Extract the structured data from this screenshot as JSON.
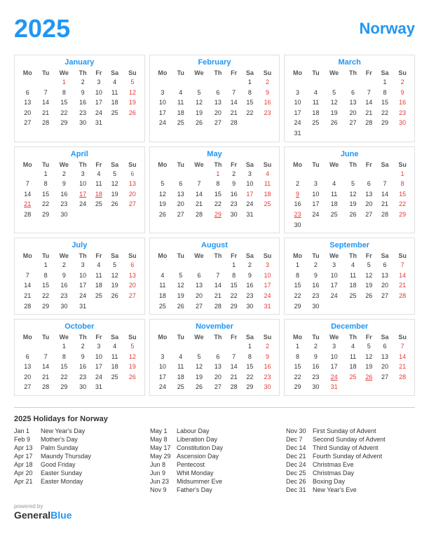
{
  "header": {
    "year": "2025",
    "country": "Norway"
  },
  "months": [
    {
      "name": "January",
      "days": [
        [
          "",
          "",
          "1",
          "2",
          "3",
          "4",
          "5"
        ],
        [
          "6",
          "7",
          "8",
          "9",
          "10",
          "11",
          "12"
        ],
        [
          "13",
          "14",
          "15",
          "16",
          "17",
          "18",
          "19"
        ],
        [
          "20",
          "21",
          "22",
          "23",
          "24",
          "25",
          "26"
        ],
        [
          "27",
          "28",
          "29",
          "30",
          "31",
          "",
          ""
        ]
      ],
      "red_days": [
        "1"
      ],
      "underline_days": []
    },
    {
      "name": "February",
      "days": [
        [
          "",
          "",
          "",
          "",
          "",
          "1",
          "2"
        ],
        [
          "3",
          "4",
          "5",
          "6",
          "7",
          "8",
          "9"
        ],
        [
          "10",
          "11",
          "12",
          "13",
          "14",
          "15",
          "16"
        ],
        [
          "17",
          "18",
          "19",
          "20",
          "21",
          "22",
          "23"
        ],
        [
          "24",
          "25",
          "26",
          "27",
          "28",
          "",
          ""
        ]
      ],
      "red_days": [],
      "underline_days": []
    },
    {
      "name": "March",
      "days": [
        [
          "",
          "",
          "",
          "",
          "",
          "1",
          "2"
        ],
        [
          "3",
          "4",
          "5",
          "6",
          "7",
          "8",
          "9"
        ],
        [
          "10",
          "11",
          "12",
          "13",
          "14",
          "15",
          "16"
        ],
        [
          "17",
          "18",
          "19",
          "20",
          "21",
          "22",
          "23"
        ],
        [
          "24",
          "25",
          "26",
          "27",
          "28",
          "29",
          "30"
        ],
        [
          "31",
          "",
          "",
          "",
          "",
          "",
          ""
        ]
      ],
      "red_days": [
        "2"
      ],
      "underline_days": []
    },
    {
      "name": "April",
      "days": [
        [
          "",
          "1",
          "2",
          "3",
          "4",
          "5",
          "6"
        ],
        [
          "7",
          "8",
          "9",
          "10",
          "11",
          "12",
          "13"
        ],
        [
          "14",
          "15",
          "16",
          "17",
          "18",
          "19",
          "20"
        ],
        [
          "21",
          "22",
          "23",
          "24",
          "25",
          "26",
          "27"
        ],
        [
          "28",
          "29",
          "30",
          "",
          "",
          "",
          ""
        ]
      ],
      "red_days": [
        "13",
        "20"
      ],
      "underline_days": [
        "17",
        "18",
        "21"
      ]
    },
    {
      "name": "May",
      "days": [
        [
          "",
          "",
          "",
          "1",
          "2",
          "3",
          "4"
        ],
        [
          "5",
          "6",
          "7",
          "8",
          "9",
          "10",
          "11"
        ],
        [
          "12",
          "13",
          "14",
          "15",
          "16",
          "17",
          "18"
        ],
        [
          "19",
          "20",
          "21",
          "22",
          "23",
          "24",
          "25"
        ],
        [
          "26",
          "27",
          "28",
          "29",
          "30",
          "31",
          ""
        ]
      ],
      "red_days": [
        "1",
        "4",
        "17"
      ],
      "underline_days": [
        "29"
      ]
    },
    {
      "name": "June",
      "days": [
        [
          "",
          "",
          "",
          "",
          "",
          "",
          "1"
        ],
        [
          "2",
          "3",
          "4",
          "5",
          "6",
          "7",
          "8"
        ],
        [
          "9",
          "10",
          "11",
          "12",
          "13",
          "14",
          "15"
        ],
        [
          "16",
          "17",
          "18",
          "19",
          "20",
          "21",
          "22"
        ],
        [
          "23",
          "24",
          "25",
          "26",
          "27",
          "28",
          "29"
        ],
        [
          "30",
          "",
          "",
          "",
          "",
          "",
          ""
        ]
      ],
      "red_days": [
        "1",
        "8"
      ],
      "underline_days": [
        "9",
        "23"
      ]
    },
    {
      "name": "July",
      "days": [
        [
          "",
          "1",
          "2",
          "3",
          "4",
          "5",
          "6"
        ],
        [
          "7",
          "8",
          "9",
          "10",
          "11",
          "12",
          "13"
        ],
        [
          "14",
          "15",
          "16",
          "17",
          "18",
          "19",
          "20"
        ],
        [
          "21",
          "22",
          "23",
          "24",
          "25",
          "26",
          "27"
        ],
        [
          "28",
          "29",
          "30",
          "31",
          "",
          "",
          ""
        ]
      ],
      "red_days": [],
      "underline_days": []
    },
    {
      "name": "August",
      "days": [
        [
          "",
          "",
          "",
          "",
          "1",
          "2",
          "3"
        ],
        [
          "4",
          "5",
          "6",
          "7",
          "8",
          "9",
          "10"
        ],
        [
          "11",
          "12",
          "13",
          "14",
          "15",
          "16",
          "17"
        ],
        [
          "18",
          "19",
          "20",
          "21",
          "22",
          "23",
          "24"
        ],
        [
          "25",
          "26",
          "27",
          "28",
          "29",
          "30",
          "31"
        ]
      ],
      "red_days": [],
      "underline_days": []
    },
    {
      "name": "September",
      "days": [
        [
          "1",
          "2",
          "3",
          "4",
          "5",
          "6",
          "7"
        ],
        [
          "8",
          "9",
          "10",
          "11",
          "12",
          "13",
          "14"
        ],
        [
          "15",
          "16",
          "17",
          "18",
          "19",
          "20",
          "21"
        ],
        [
          "22",
          "23",
          "24",
          "25",
          "26",
          "27",
          "28"
        ],
        [
          "29",
          "30",
          "",
          "",
          "",
          "",
          ""
        ]
      ],
      "red_days": [],
      "underline_days": []
    },
    {
      "name": "October",
      "days": [
        [
          "",
          "",
          "1",
          "2",
          "3",
          "4",
          "5"
        ],
        [
          "6",
          "7",
          "8",
          "9",
          "10",
          "11",
          "12"
        ],
        [
          "13",
          "14",
          "15",
          "16",
          "17",
          "18",
          "19"
        ],
        [
          "20",
          "21",
          "22",
          "23",
          "24",
          "25",
          "26"
        ],
        [
          "27",
          "28",
          "29",
          "30",
          "31",
          "",
          ""
        ]
      ],
      "red_days": [],
      "underline_days": []
    },
    {
      "name": "November",
      "days": [
        [
          "",
          "",
          "",
          "",
          "",
          "1",
          "2"
        ],
        [
          "3",
          "4",
          "5",
          "6",
          "7",
          "8",
          "9"
        ],
        [
          "10",
          "11",
          "12",
          "13",
          "14",
          "15",
          "16"
        ],
        [
          "17",
          "18",
          "19",
          "20",
          "21",
          "22",
          "23"
        ],
        [
          "24",
          "25",
          "26",
          "27",
          "28",
          "29",
          "30"
        ]
      ],
      "red_days": [
        "9",
        "30"
      ],
      "underline_days": []
    },
    {
      "name": "December",
      "days": [
        [
          "1",
          "2",
          "3",
          "4",
          "5",
          "6",
          "7"
        ],
        [
          "8",
          "9",
          "10",
          "11",
          "12",
          "13",
          "14"
        ],
        [
          "15",
          "16",
          "17",
          "18",
          "19",
          "20",
          "21"
        ],
        [
          "22",
          "23",
          "24",
          "25",
          "26",
          "27",
          "28"
        ],
        [
          "29",
          "30",
          "31",
          "",
          "",
          "",
          ""
        ]
      ],
      "red_days": [
        "7",
        "14",
        "21",
        "25",
        "31"
      ],
      "underline_days": [
        "24",
        "26"
      ]
    }
  ],
  "weekdays": [
    "Mo",
    "Tu",
    "We",
    "Th",
    "Fr",
    "Sa",
    "Su"
  ],
  "holidays_title": "2025 Holidays for Norway",
  "holidays_col1": [
    {
      "date": "Jan 1",
      "name": "New Year's Day"
    },
    {
      "date": "Feb 9",
      "name": "Mother's Day"
    },
    {
      "date": "Apr 13",
      "name": "Palm Sunday"
    },
    {
      "date": "Apr 17",
      "name": "Maundy Thursday"
    },
    {
      "date": "Apr 18",
      "name": "Good Friday"
    },
    {
      "date": "Apr 20",
      "name": "Easter Sunday"
    },
    {
      "date": "Apr 21",
      "name": "Easter Monday"
    }
  ],
  "holidays_col2": [
    {
      "date": "May 1",
      "name": "Labour Day"
    },
    {
      "date": "May 8",
      "name": "Liberation Day"
    },
    {
      "date": "May 17",
      "name": "Constitution Day"
    },
    {
      "date": "May 29",
      "name": "Ascension Day"
    },
    {
      "date": "Jun 8",
      "name": "Pentecost"
    },
    {
      "date": "Jun 9",
      "name": "Whit Monday"
    },
    {
      "date": "Jun 23",
      "name": "Midsummer Eve"
    },
    {
      "date": "Nov 9",
      "name": "Father's Day"
    }
  ],
  "holidays_col3": [
    {
      "date": "Nov 30",
      "name": "First Sunday of Advent"
    },
    {
      "date": "Dec 7",
      "name": "Second Sunday of Advent"
    },
    {
      "date": "Dec 14",
      "name": "Third Sunday of Advent"
    },
    {
      "date": "Dec 21",
      "name": "Fourth Sunday of Advent"
    },
    {
      "date": "Dec 24",
      "name": "Christmas Eve"
    },
    {
      "date": "Dec 25",
      "name": "Christmas Day"
    },
    {
      "date": "Dec 26",
      "name": "Boxing Day"
    },
    {
      "date": "Dec 31",
      "name": "New Year's Eve"
    }
  ],
  "footer": {
    "powered_by": "powered by",
    "brand_black": "General",
    "brand_blue": "Blue"
  }
}
